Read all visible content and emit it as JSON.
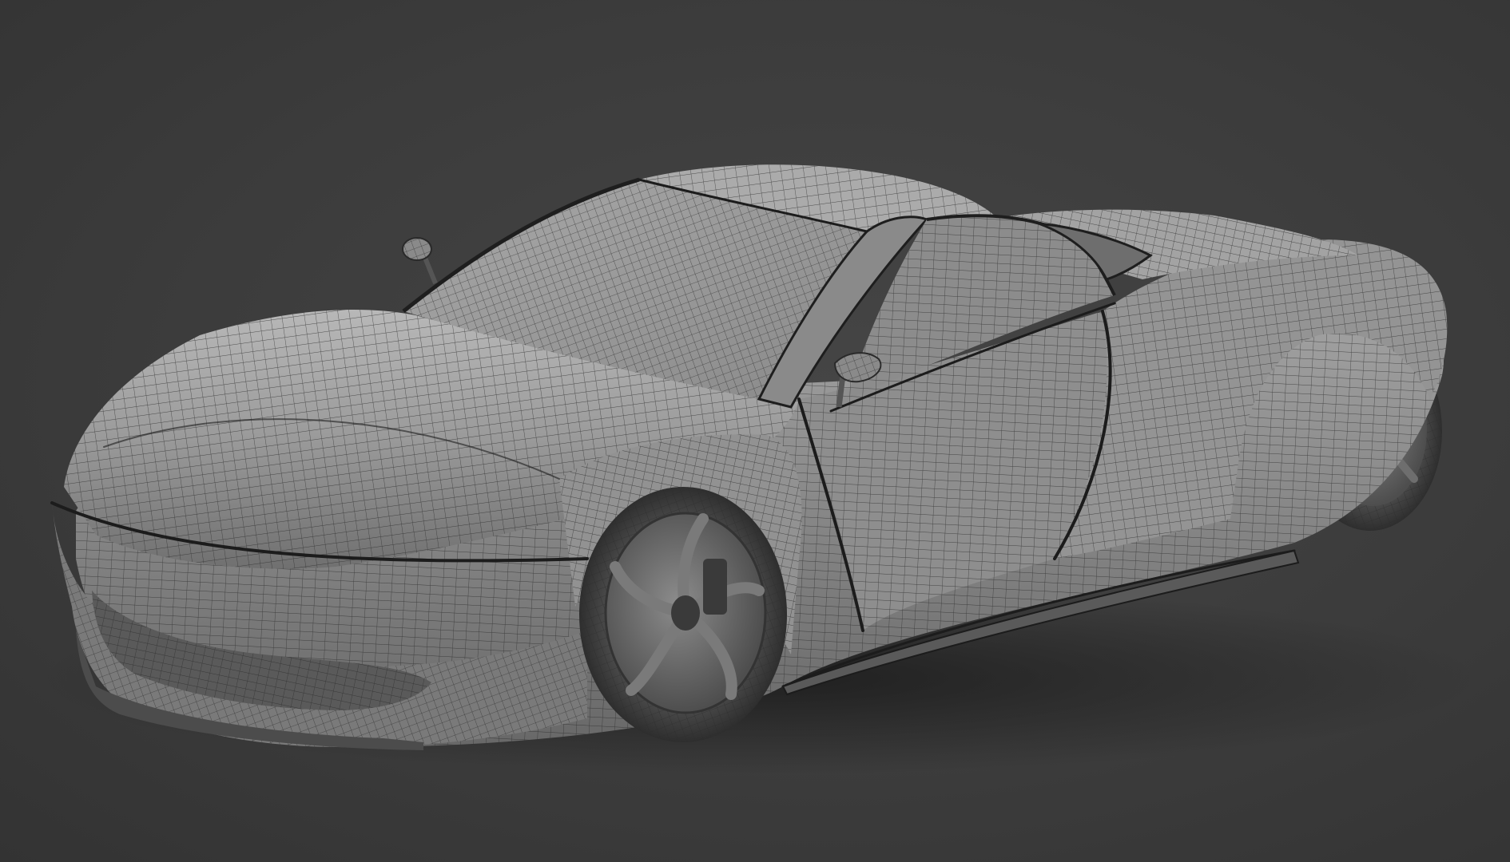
{
  "scene": {
    "subject": "wireframe-sports-car",
    "colors": {
      "background": "#3b3b3b",
      "body": "#8f8f8f",
      "body_light": "#b4b4b4",
      "body_dark": "#5e5e5e",
      "wire": "#2a2a2a",
      "tire": "#4a4a4a",
      "shadow": "#1f1f1f"
    }
  }
}
